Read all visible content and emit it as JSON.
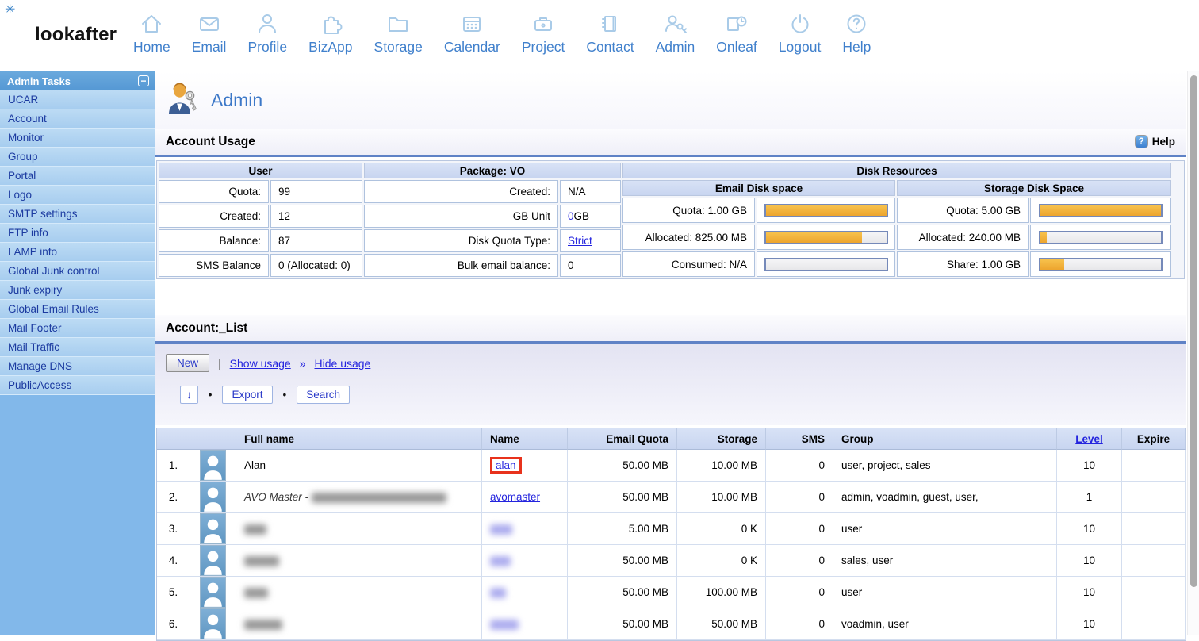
{
  "brand": {
    "logo": "lookafter",
    "gear_glyph": "✳"
  },
  "nav": {
    "items": [
      {
        "label": "Home",
        "icon": "home-icon"
      },
      {
        "label": "Email",
        "icon": "email-icon"
      },
      {
        "label": "Profile",
        "icon": "profile-icon"
      },
      {
        "label": "BizApp",
        "icon": "puzzle-icon"
      },
      {
        "label": "Storage",
        "icon": "folder-icon"
      },
      {
        "label": "Calendar",
        "icon": "calendar-icon"
      },
      {
        "label": "Project",
        "icon": "briefcase-icon"
      },
      {
        "label": "Contact",
        "icon": "notebook-icon"
      },
      {
        "label": "Admin",
        "icon": "admin-key-icon"
      },
      {
        "label": "Onleaf",
        "icon": "doc-clock-icon"
      },
      {
        "label": "Logout",
        "icon": "power-icon"
      },
      {
        "label": "Help",
        "icon": "question-icon"
      }
    ]
  },
  "sidebar": {
    "title": "Admin Tasks",
    "collapse_glyph": "−",
    "items": [
      "UCAR",
      "Account",
      "Monitor",
      "Group",
      "Portal",
      "Logo",
      "SMTP settings",
      "FTP info",
      "LAMP info",
      "Global Junk control",
      "Junk expiry",
      "Global Email Rules",
      "Mail Footer",
      "Mail Traffic",
      "Manage DNS",
      "PublicAccess"
    ]
  },
  "page": {
    "title": "Admin"
  },
  "account_usage": {
    "heading": "Account Usage",
    "help_label": "Help",
    "help_glyph": "?",
    "user": {
      "header": "User",
      "rows": [
        {
          "label": "Quota:",
          "value": "99"
        },
        {
          "label": "Created:",
          "value": "12"
        },
        {
          "label": "Balance:",
          "value": "87"
        },
        {
          "label": "SMS Balance",
          "value": "0 (Allocated: 0)"
        }
      ]
    },
    "package": {
      "header": "Package: VO",
      "rows": [
        {
          "label": "Created:",
          "value": "N/A"
        },
        {
          "label": "GB Unit",
          "value_link": "0",
          "value_suffix": " GB"
        },
        {
          "label": "Disk Quota Type:",
          "value_link": "Strict"
        },
        {
          "label": "Bulk email balance:",
          "value": "0"
        }
      ]
    },
    "disk": {
      "header": "Disk Resources",
      "email": {
        "header": "Email Disk space",
        "rows": [
          {
            "label": "Quota: 1.00 GB",
            "percent": 100
          },
          {
            "label": "Allocated: 825.00 MB",
            "percent": 80
          },
          {
            "label": "Consumed: N/A",
            "percent": 0
          }
        ]
      },
      "storage": {
        "header": "Storage Disk Space",
        "rows": [
          {
            "label": "Quota: 5.00 GB",
            "percent": 100
          },
          {
            "label": "Allocated: 240.00 MB",
            "percent": 5
          },
          {
            "label": "Share: 1.00 GB",
            "percent": 20
          }
        ]
      }
    }
  },
  "account_list": {
    "heading": "Account:_List",
    "toolbar": {
      "new_label": "New",
      "pipe": "|",
      "show_usage": "Show usage",
      "chevron": "»",
      "hide_usage": "Hide usage",
      "sort_label": "↓",
      "dot": "•",
      "export_label": "Export",
      "search_label": "Search"
    },
    "columns": [
      "",
      "",
      "Full name",
      "Name",
      "Email Quota",
      "Storage",
      "SMS",
      "Group",
      "Level",
      "Expire"
    ],
    "rows": [
      {
        "num": "1.",
        "full_name": "Alan",
        "name": "alan",
        "name_highlight": true,
        "email_quota": "50.00 MB",
        "storage": "10.00 MB",
        "sms": "0",
        "group": "user, project, sales",
        "level": "10",
        "expire": ""
      },
      {
        "num": "2.",
        "full_name": "AVO Master -",
        "full_name_italic": true,
        "full_name_redact_width": 170,
        "name": "avomaster",
        "email_quota": "50.00 MB",
        "storage": "10.00 MB",
        "sms": "0",
        "group": "admin, voadmin, guest, user,",
        "level": "1",
        "expire": ""
      },
      {
        "num": "3.",
        "full_name": "",
        "full_name_redact_width": 28,
        "name": "",
        "name_redact_width": 28,
        "email_quota": "5.00 MB",
        "storage": "0 K",
        "sms": "0",
        "group": "user",
        "level": "10",
        "expire": ""
      },
      {
        "num": "4.",
        "full_name": "",
        "full_name_redact_width": 44,
        "name": "",
        "name_redact_width": 26,
        "email_quota": "50.00 MB",
        "storage": "0 K",
        "sms": "0",
        "group": "sales, user",
        "level": "10",
        "expire": ""
      },
      {
        "num": "5.",
        "full_name": "",
        "full_name_redact_width": 30,
        "name": "",
        "name_redact_width": 20,
        "email_quota": "50.00 MB",
        "storage": "100.00 MB",
        "sms": "0",
        "group": "user",
        "level": "10",
        "expire": ""
      },
      {
        "num": "6.",
        "full_name": "",
        "full_name_redact_width": 48,
        "name": "",
        "name_redact_width": 36,
        "email_quota": "50.00 MB",
        "storage": "50.00 MB",
        "sms": "0",
        "group": "voadmin, user",
        "level": "10",
        "expire": ""
      }
    ]
  },
  "colors": {
    "nav_label_blue": "#4080CC",
    "icon_light_blue": "#A9CBE8",
    "sidebar_header_blue": "#5C9ED8",
    "sidebar_item_blue": "#ABCFF0",
    "sidebar_fill_blue": "#82B8EA",
    "sidebar_text_blue": "#1B3AA0",
    "accent_rule_blue": "#5F82C6",
    "table_header_blue": "#CDD9F3",
    "link_blue": "#2424DE",
    "bar_orange": "#F0AF3C",
    "bar_border_blue": "#7589B9",
    "highlight_red": "#E8321C",
    "toolbar_lavender": "#E3E3F2"
  }
}
